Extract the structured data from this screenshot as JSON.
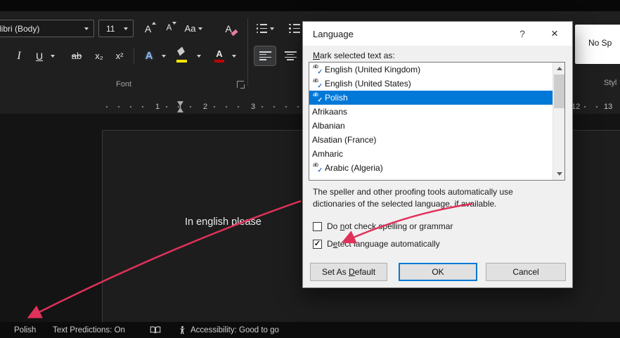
{
  "ribbon": {
    "font_name": "libri (Body)",
    "font_size": "11",
    "grow_font_label": "A",
    "shrink_font_label": "A",
    "change_case_label": "Aa",
    "clear_formatting_label": "A",
    "italic_label": "I",
    "underline_label": "U",
    "strikethrough_label": "ab",
    "subscript_label": "x₂",
    "superscript_label": "x²",
    "text_effects_label": "A",
    "font_color_label": "A",
    "font_group_label": "Font"
  },
  "ruler": {
    "marks_left": [
      "1",
      "2",
      "3"
    ],
    "marks_right": [
      "12",
      "13"
    ]
  },
  "document": {
    "text": "In english please"
  },
  "styles_pane": {
    "card_label": "No Sp",
    "group_label": "Styl"
  },
  "dialog": {
    "title": "Language",
    "help_label": "?",
    "close_label": "×",
    "mark_label": {
      "pre": "",
      "key": "M",
      "post": "ark selected text as:"
    },
    "languages": [
      {
        "name": "English (United Kingdom)",
        "spell": true
      },
      {
        "name": "English (United States)",
        "spell": true
      },
      {
        "name": "Polish",
        "spell": true
      },
      {
        "name": "Afrikaans",
        "spell": false
      },
      {
        "name": "Albanian",
        "spell": false
      },
      {
        "name": "Alsatian (France)",
        "spell": false
      },
      {
        "name": "Amharic",
        "spell": false
      },
      {
        "name": "Arabic (Algeria)",
        "spell": true
      }
    ],
    "selected_language": "Polish",
    "description_line1": "The speller and other proofing tools automatically use",
    "description_line2": "dictionaries of the selected language, if available.",
    "checkbox_no_check": {
      "pre": "Do ",
      "key": "n",
      "post": "ot check spelling or grammar",
      "checked": false
    },
    "checkbox_detect": {
      "pre": "D",
      "key": "e",
      "post": "tect language automatically",
      "checked": true
    },
    "set_default_button": {
      "pre": "Set As ",
      "key": "D",
      "post": "efault"
    },
    "ok_button": "OK",
    "cancel_button": "Cancel"
  },
  "status_bar": {
    "language": "Polish",
    "text_predictions": "Text Predictions: On",
    "accessibility": "Accessibility: Good to go"
  },
  "colors": {
    "selection_blue": "#0078d7",
    "annotation_red": "#e0315a",
    "highlight_yellow": "#f3e600",
    "font_color_red": "#c00000"
  }
}
